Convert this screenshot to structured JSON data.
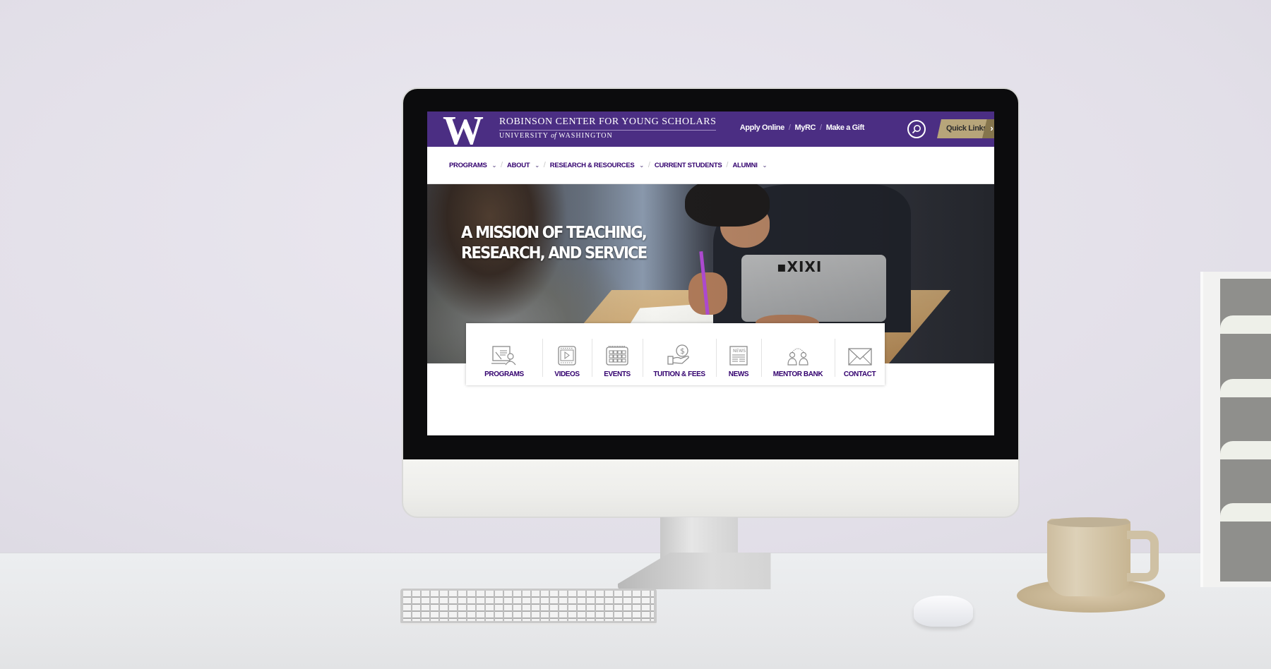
{
  "brand": {
    "logo_letter": "W",
    "title": "ROBINSON CENTER FOR YOUNG SCHOLARS",
    "subtitle_pre": "UNIVERSITY",
    "subtitle_of": "of",
    "subtitle_post": "WASHINGTON",
    "color_primary": "#4b2e83",
    "color_gold": "#b7a57a"
  },
  "utility": {
    "links": [
      "Apply Online",
      "MyRC",
      "Make a Gift"
    ],
    "search_icon": "search-icon",
    "quick_links_label": "Quick Links",
    "quick_links_arrow": "›"
  },
  "nav": {
    "items": [
      {
        "label": "PROGRAMS",
        "has_dropdown": true
      },
      {
        "label": "ABOUT",
        "has_dropdown": true
      },
      {
        "label": "RESEARCH & RESOURCES",
        "has_dropdown": true
      },
      {
        "label": "CURRENT STUDENTS",
        "has_dropdown": false
      },
      {
        "label": "ALUMNI",
        "has_dropdown": true
      }
    ],
    "chevron": "⌄",
    "separator": "/"
  },
  "hero": {
    "line1": "A MISSION OF TEACHING,",
    "line2": "RESEARCH, AND SERVICE",
    "shirt_print": "▪XIXI"
  },
  "quick_tiles": [
    {
      "label": "PROGRAMS",
      "icon": "presentation-icon"
    },
    {
      "label": "VIDEOS",
      "icon": "video-icon"
    },
    {
      "label": "EVENTS",
      "icon": "calendar-icon"
    },
    {
      "label": "TUITION & FEES",
      "icon": "money-hand-icon"
    },
    {
      "label": "NEWS",
      "icon": "newspaper-icon"
    },
    {
      "label": "MENTOR BANK",
      "icon": "mentor-icon"
    },
    {
      "label": "CONTACT",
      "icon": "envelope-icon"
    }
  ],
  "news_icon_text": "NEWS"
}
